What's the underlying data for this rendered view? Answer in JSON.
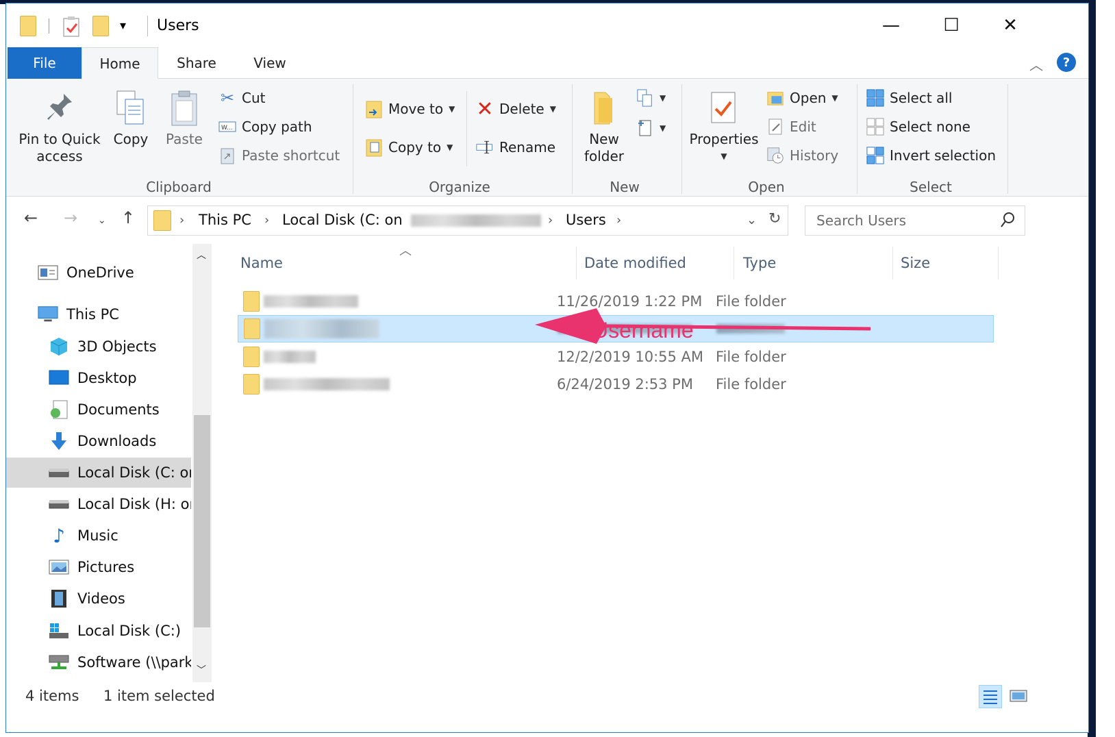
{
  "window": {
    "title": "Users",
    "min_glyph": "—",
    "max_glyph": "☐",
    "close_glyph": "✕"
  },
  "tabs": {
    "file": "File",
    "home": "Home",
    "share": "Share",
    "view": "View",
    "help_glyph": "?"
  },
  "ribbon": {
    "clipboard": {
      "pin": "Pin to Quick\naccess",
      "copy": "Copy",
      "paste": "Paste",
      "cut": "Cut",
      "copy_path": "Copy path",
      "paste_shortcut": "Paste shortcut",
      "label": "Clipboard"
    },
    "organize": {
      "move_to": "Move to",
      "copy_to": "Copy to",
      "delete": "Delete",
      "rename": "Rename",
      "label": "Organize"
    },
    "new": {
      "new_folder": "New\nfolder",
      "label": "New"
    },
    "open": {
      "properties": "Properties",
      "open": "Open",
      "edit": "Edit",
      "history": "History",
      "label": "Open"
    },
    "select": {
      "select_all": "Select all",
      "select_none": "Select none",
      "invert": "Invert selection",
      "label": "Select"
    }
  },
  "address": {
    "this_pc": "This PC",
    "local_disk": "Local Disk (C: on",
    "users": "Users",
    "search_placeholder": "Search Users"
  },
  "navpane": {
    "items": [
      {
        "label": "OneDrive",
        "icon": "onedrive-icon"
      },
      {
        "label": "This PC",
        "icon": "this-pc-icon"
      },
      {
        "label": "3D Objects",
        "icon": "3d-objects-icon"
      },
      {
        "label": "Desktop",
        "icon": "desktop-icon"
      },
      {
        "label": "Documents",
        "icon": "documents-icon"
      },
      {
        "label": "Downloads",
        "icon": "downloads-icon"
      },
      {
        "label": "Local Disk (C: on",
        "icon": "drive-icon"
      },
      {
        "label": "Local Disk (H: on",
        "icon": "drive-icon"
      },
      {
        "label": "Music",
        "icon": "music-icon"
      },
      {
        "label": "Pictures",
        "icon": "pictures-icon"
      },
      {
        "label": "Videos",
        "icon": "videos-icon"
      },
      {
        "label": "Local Disk (C:)",
        "icon": "windows-drive-icon"
      },
      {
        "label": "Software (\\\\park",
        "icon": "network-drive-icon"
      }
    ]
  },
  "columns": {
    "name": "Name",
    "date": "Date modified",
    "type": "Type",
    "size": "Size"
  },
  "files": [
    {
      "date": "11/26/2019 1:22 PM",
      "type": "File folder"
    },
    {
      "date": "",
      "type": ""
    },
    {
      "date": "12/2/2019 10:55 AM",
      "type": "File folder"
    },
    {
      "date": "6/24/2019 2:53 PM",
      "type": "File folder"
    }
  ],
  "annotation": {
    "text": "Username",
    "color": "#e8336e"
  },
  "status": {
    "items": "4 items",
    "selected": "1 item selected"
  },
  "colors": {
    "accent": "#1a6ec7",
    "selection": "#cce8ff"
  }
}
